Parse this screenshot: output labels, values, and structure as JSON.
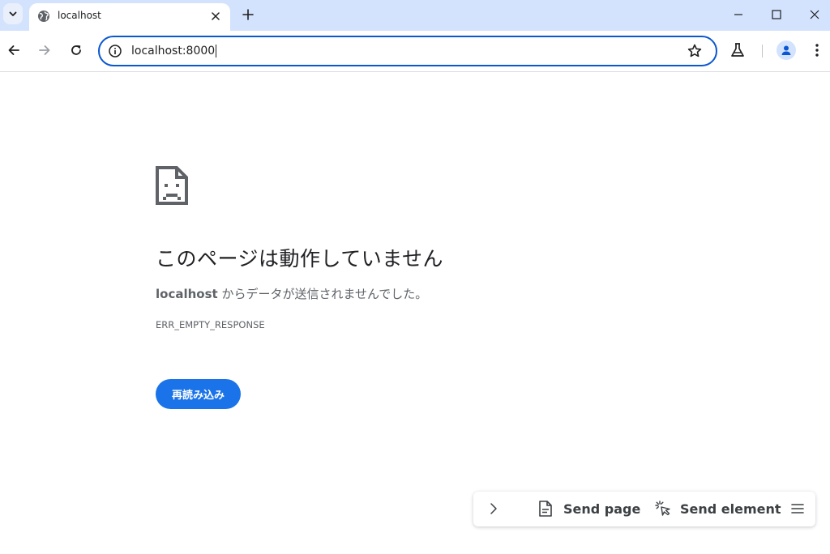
{
  "browser": {
    "tab": {
      "title": "localhost"
    },
    "address_bar": {
      "url": "localhost:8000"
    },
    "icons": {
      "tab_search": "chevron-down-icon",
      "tab_favicon": "globe-icon",
      "tab_close": "close-icon",
      "new_tab": "plus-icon",
      "minimize": "minimize-icon",
      "maximize": "maximize-icon",
      "close_window": "close-icon",
      "back": "arrow-left-icon",
      "forward": "arrow-right-icon",
      "reload": "reload-icon",
      "site_info": "info-icon",
      "bookmark": "star-icon",
      "labs": "flask-icon",
      "profile": "person-icon",
      "menu": "kebab-icon"
    }
  },
  "error_page": {
    "heading": "このページは動作していません",
    "host": "localhost",
    "description_suffix": " からデータが送信されませんでした。",
    "error_code": "ERR_EMPTY_RESPONSE",
    "reload_button": "再読み込み"
  },
  "extension_bar": {
    "send_page": "Send page",
    "send_element": "Send element",
    "icons": {
      "expand": "chevron-right-icon",
      "page": "document-icon",
      "element": "cursor-click-icon",
      "menu": "hamburger-icon"
    }
  },
  "colors": {
    "tabstrip_bg": "#d3e3fd",
    "accent": "#1a73e8",
    "omnibox_border": "#0b57d0"
  }
}
